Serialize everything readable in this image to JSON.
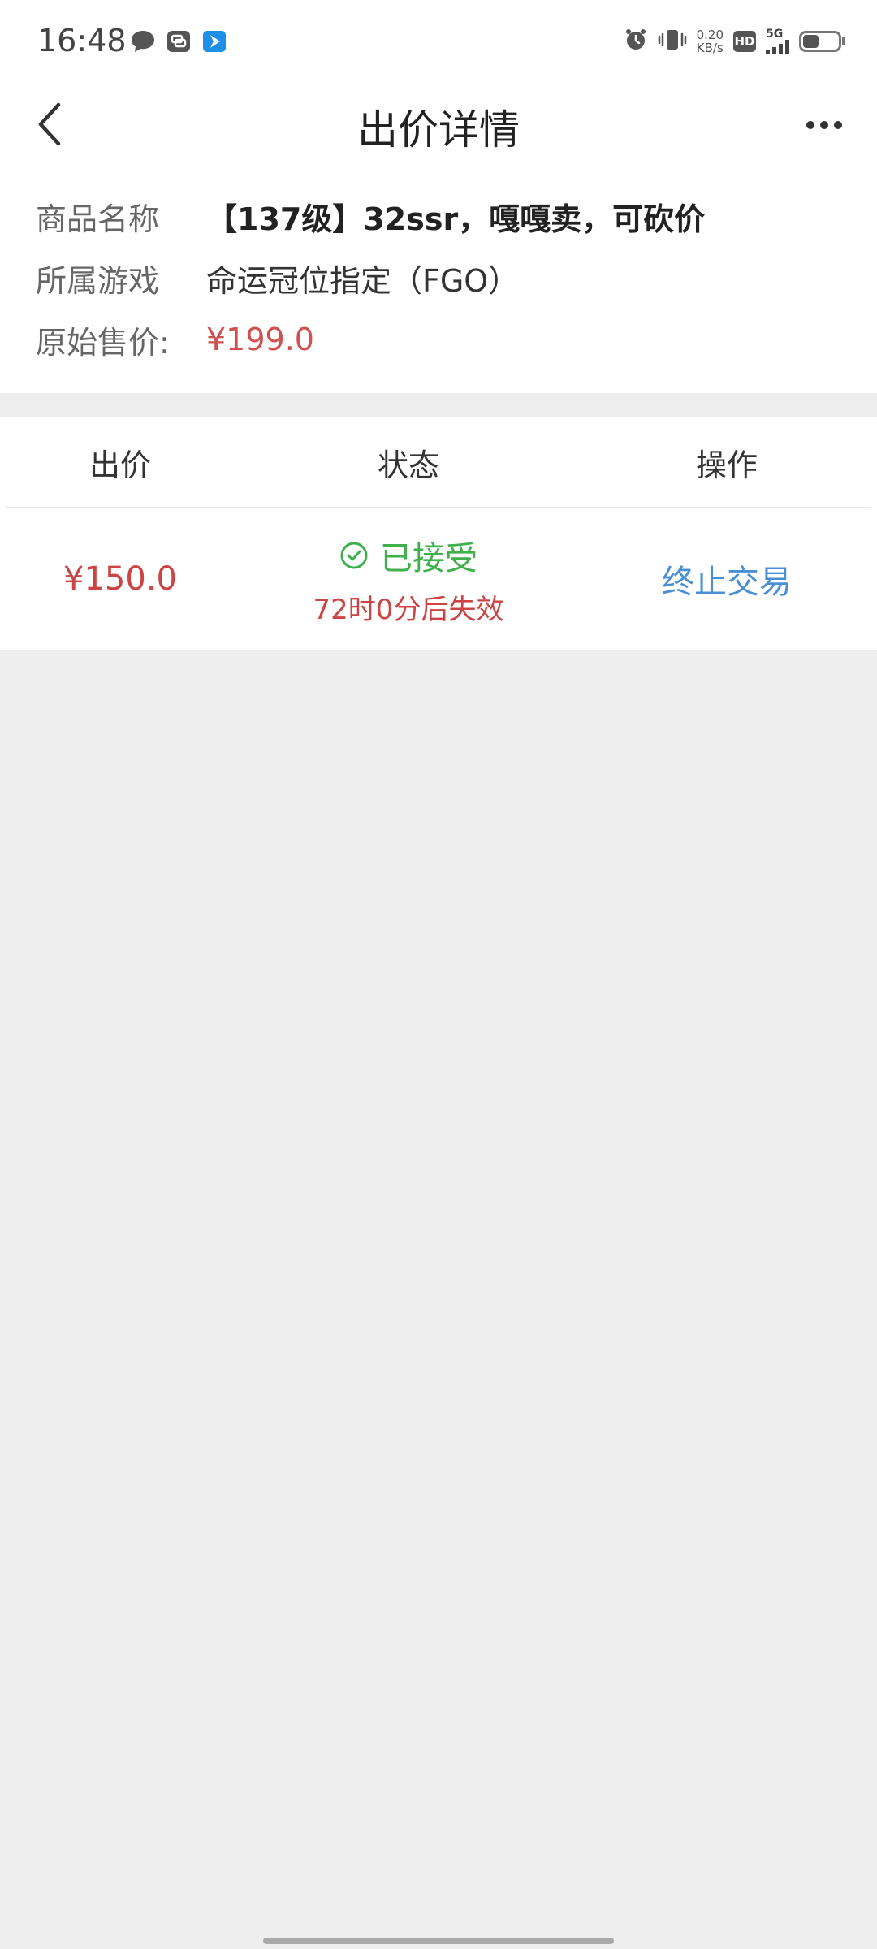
{
  "status_bar": {
    "time": "16:48",
    "net_speed_value": "0.20",
    "net_speed_unit": "KB/s",
    "hd_label": "HD",
    "signal_label": "5G",
    "battery_level": 0.45,
    "icons": [
      "chat-bubble-icon",
      "message-app-icon",
      "blue-app-icon",
      "alarm-icon",
      "vibrate-icon"
    ]
  },
  "nav": {
    "title": "出价详情"
  },
  "product": {
    "name_label": "商品名称",
    "name_value": "【137级】32ssr，嘎嘎卖，可砍价",
    "game_label": "所属游戏",
    "game_value": "命运冠位指定（FGO）",
    "price_label": "原始售价:",
    "price_value": "¥199.0"
  },
  "offers_table": {
    "columns": [
      "出价",
      "状态",
      "操作"
    ],
    "rows": [
      {
        "price": "¥150.0",
        "status": "已接受",
        "expiry": "72时0分后失效",
        "action": "终止交易"
      }
    ]
  },
  "colors": {
    "price_red": "#cc4444",
    "accepted_green": "#3fb04c",
    "link_blue": "#4a8fd6",
    "background_gray": "#eeeeee"
  }
}
